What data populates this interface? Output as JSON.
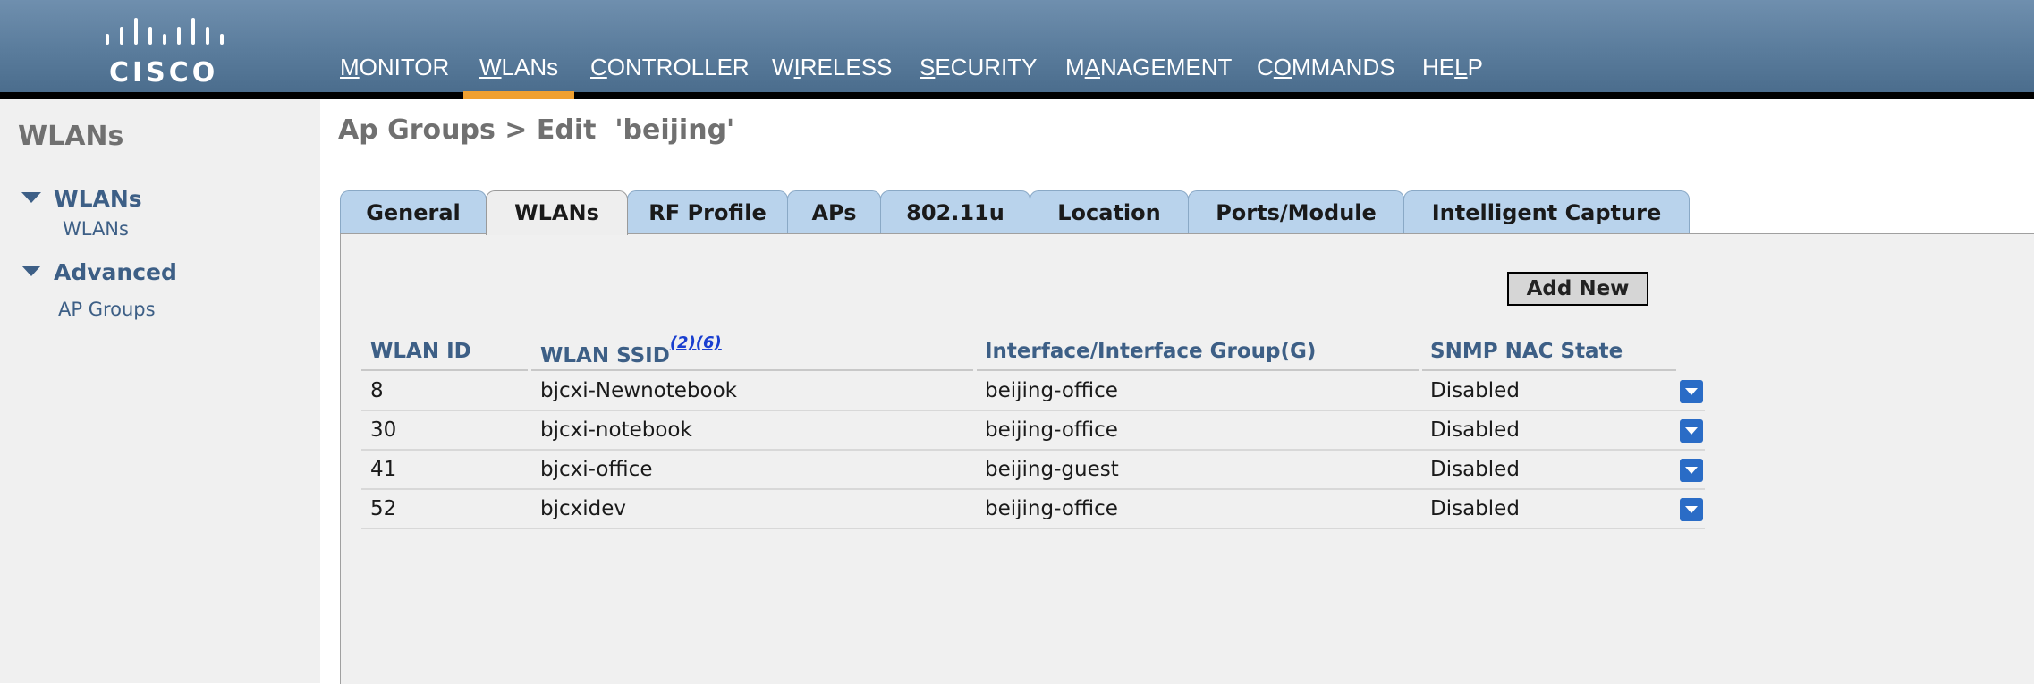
{
  "brand": {
    "name": "CISCO",
    "color": "#5a7c9c",
    "accent": "#f0a030"
  },
  "nav": {
    "items": [
      {
        "pre": "",
        "ul": "M",
        "post": "ONITOR"
      },
      {
        "pre": "",
        "ul": "W",
        "post": "LANs"
      },
      {
        "pre": "",
        "ul": "C",
        "post": "ONTROLLER"
      },
      {
        "pre": "W",
        "ul": "I",
        "post": "RELESS"
      },
      {
        "pre": "",
        "ul": "S",
        "post": "ECURITY"
      },
      {
        "pre": "M",
        "ul": "A",
        "post": "NAGEMENT"
      },
      {
        "pre": "C",
        "ul": "O",
        "post": "MMANDS"
      },
      {
        "pre": "HE",
        "ul": "L",
        "post": "P"
      }
    ],
    "active": "WLANs"
  },
  "sidebar": {
    "title": "WLANs",
    "sections": [
      {
        "label": "WLANs",
        "links": [
          "WLANs"
        ]
      },
      {
        "label": "Advanced",
        "links": [
          "AP Groups"
        ]
      }
    ]
  },
  "page": {
    "title": "Ap Groups > Edit  'beijing'"
  },
  "tabs": [
    "General",
    "WLANs",
    "RF Profile",
    "APs",
    "802.11u",
    "Location",
    "Ports/Module",
    "Intelligent Capture"
  ],
  "active_tab": "WLANs",
  "actions": {
    "add_new": "Add New"
  },
  "table": {
    "headers": {
      "wlan_id": "WLAN ID",
      "ssid": "WLAN SSID",
      "ssid_note": "(2)(6)",
      "interface": "Interface/Interface Group(G)",
      "snmp": "SNMP NAC State"
    },
    "rows": [
      {
        "id": "8",
        "ssid": "bjcxi-Newnotebook",
        "interface": "beijing-office",
        "snmp": "Disabled"
      },
      {
        "id": "30",
        "ssid": "bjcxi-notebook",
        "interface": "beijing-office",
        "snmp": "Disabled"
      },
      {
        "id": "41",
        "ssid": "bjcxi-office",
        "interface": "beijing-guest",
        "snmp": "Disabled"
      },
      {
        "id": "52",
        "ssid": "bjcxidev",
        "interface": "beijing-office",
        "snmp": "Disabled"
      }
    ]
  }
}
